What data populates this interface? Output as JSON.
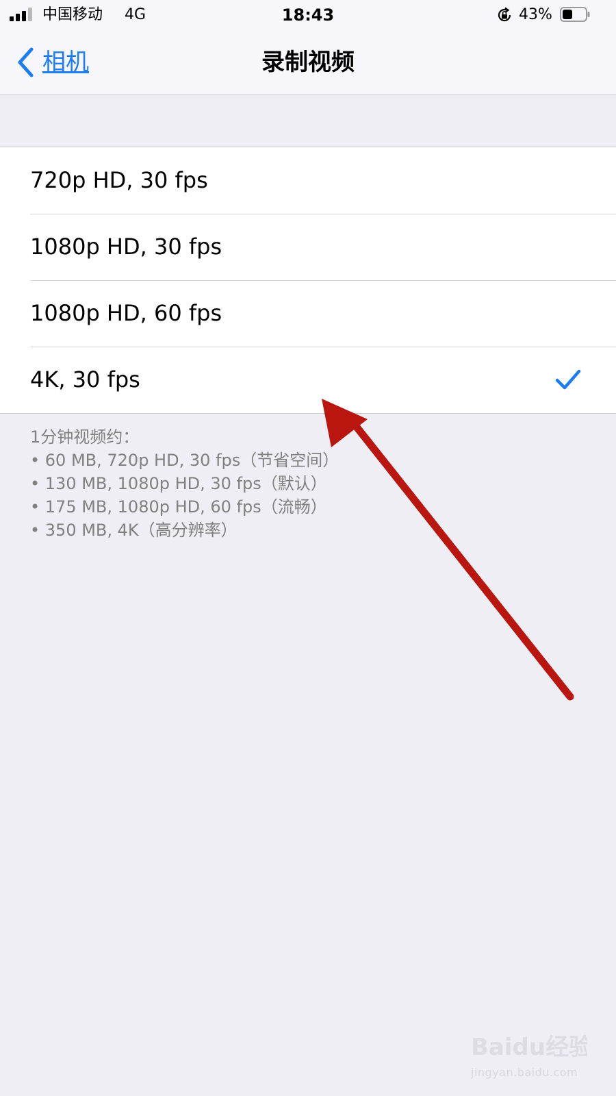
{
  "status_bar": {
    "carrier": "中国移动",
    "network": "4G",
    "time": "18:43",
    "battery_percent": "43%",
    "battery_level": 0.43,
    "signal_bars_filled": 3,
    "signal_bars_total": 4
  },
  "nav": {
    "back_label": "相机",
    "title": "录制视频",
    "accent_color": "#1a7df3"
  },
  "options": [
    {
      "label": "720p HD, 30 fps",
      "selected": false
    },
    {
      "label": "1080p HD, 30 fps",
      "selected": false
    },
    {
      "label": "1080p HD, 60 fps",
      "selected": false
    },
    {
      "label": "4K, 30 fps",
      "selected": true
    }
  ],
  "notes": {
    "heading": "1分钟视频约：",
    "lines": [
      "• 60 MB, 720p HD, 30 fps（节省空间）",
      "• 130 MB, 1080p HD, 30 fps（默认）",
      "• 175 MB, 1080p HD, 60 fps（流畅）",
      "• 350 MB, 4K（高分辨率）"
    ]
  },
  "annotation": {
    "arrow_color": "#b8160e"
  },
  "watermark": {
    "logo_text": "Baidu经验",
    "url": "jingyan.baidu.com"
  }
}
